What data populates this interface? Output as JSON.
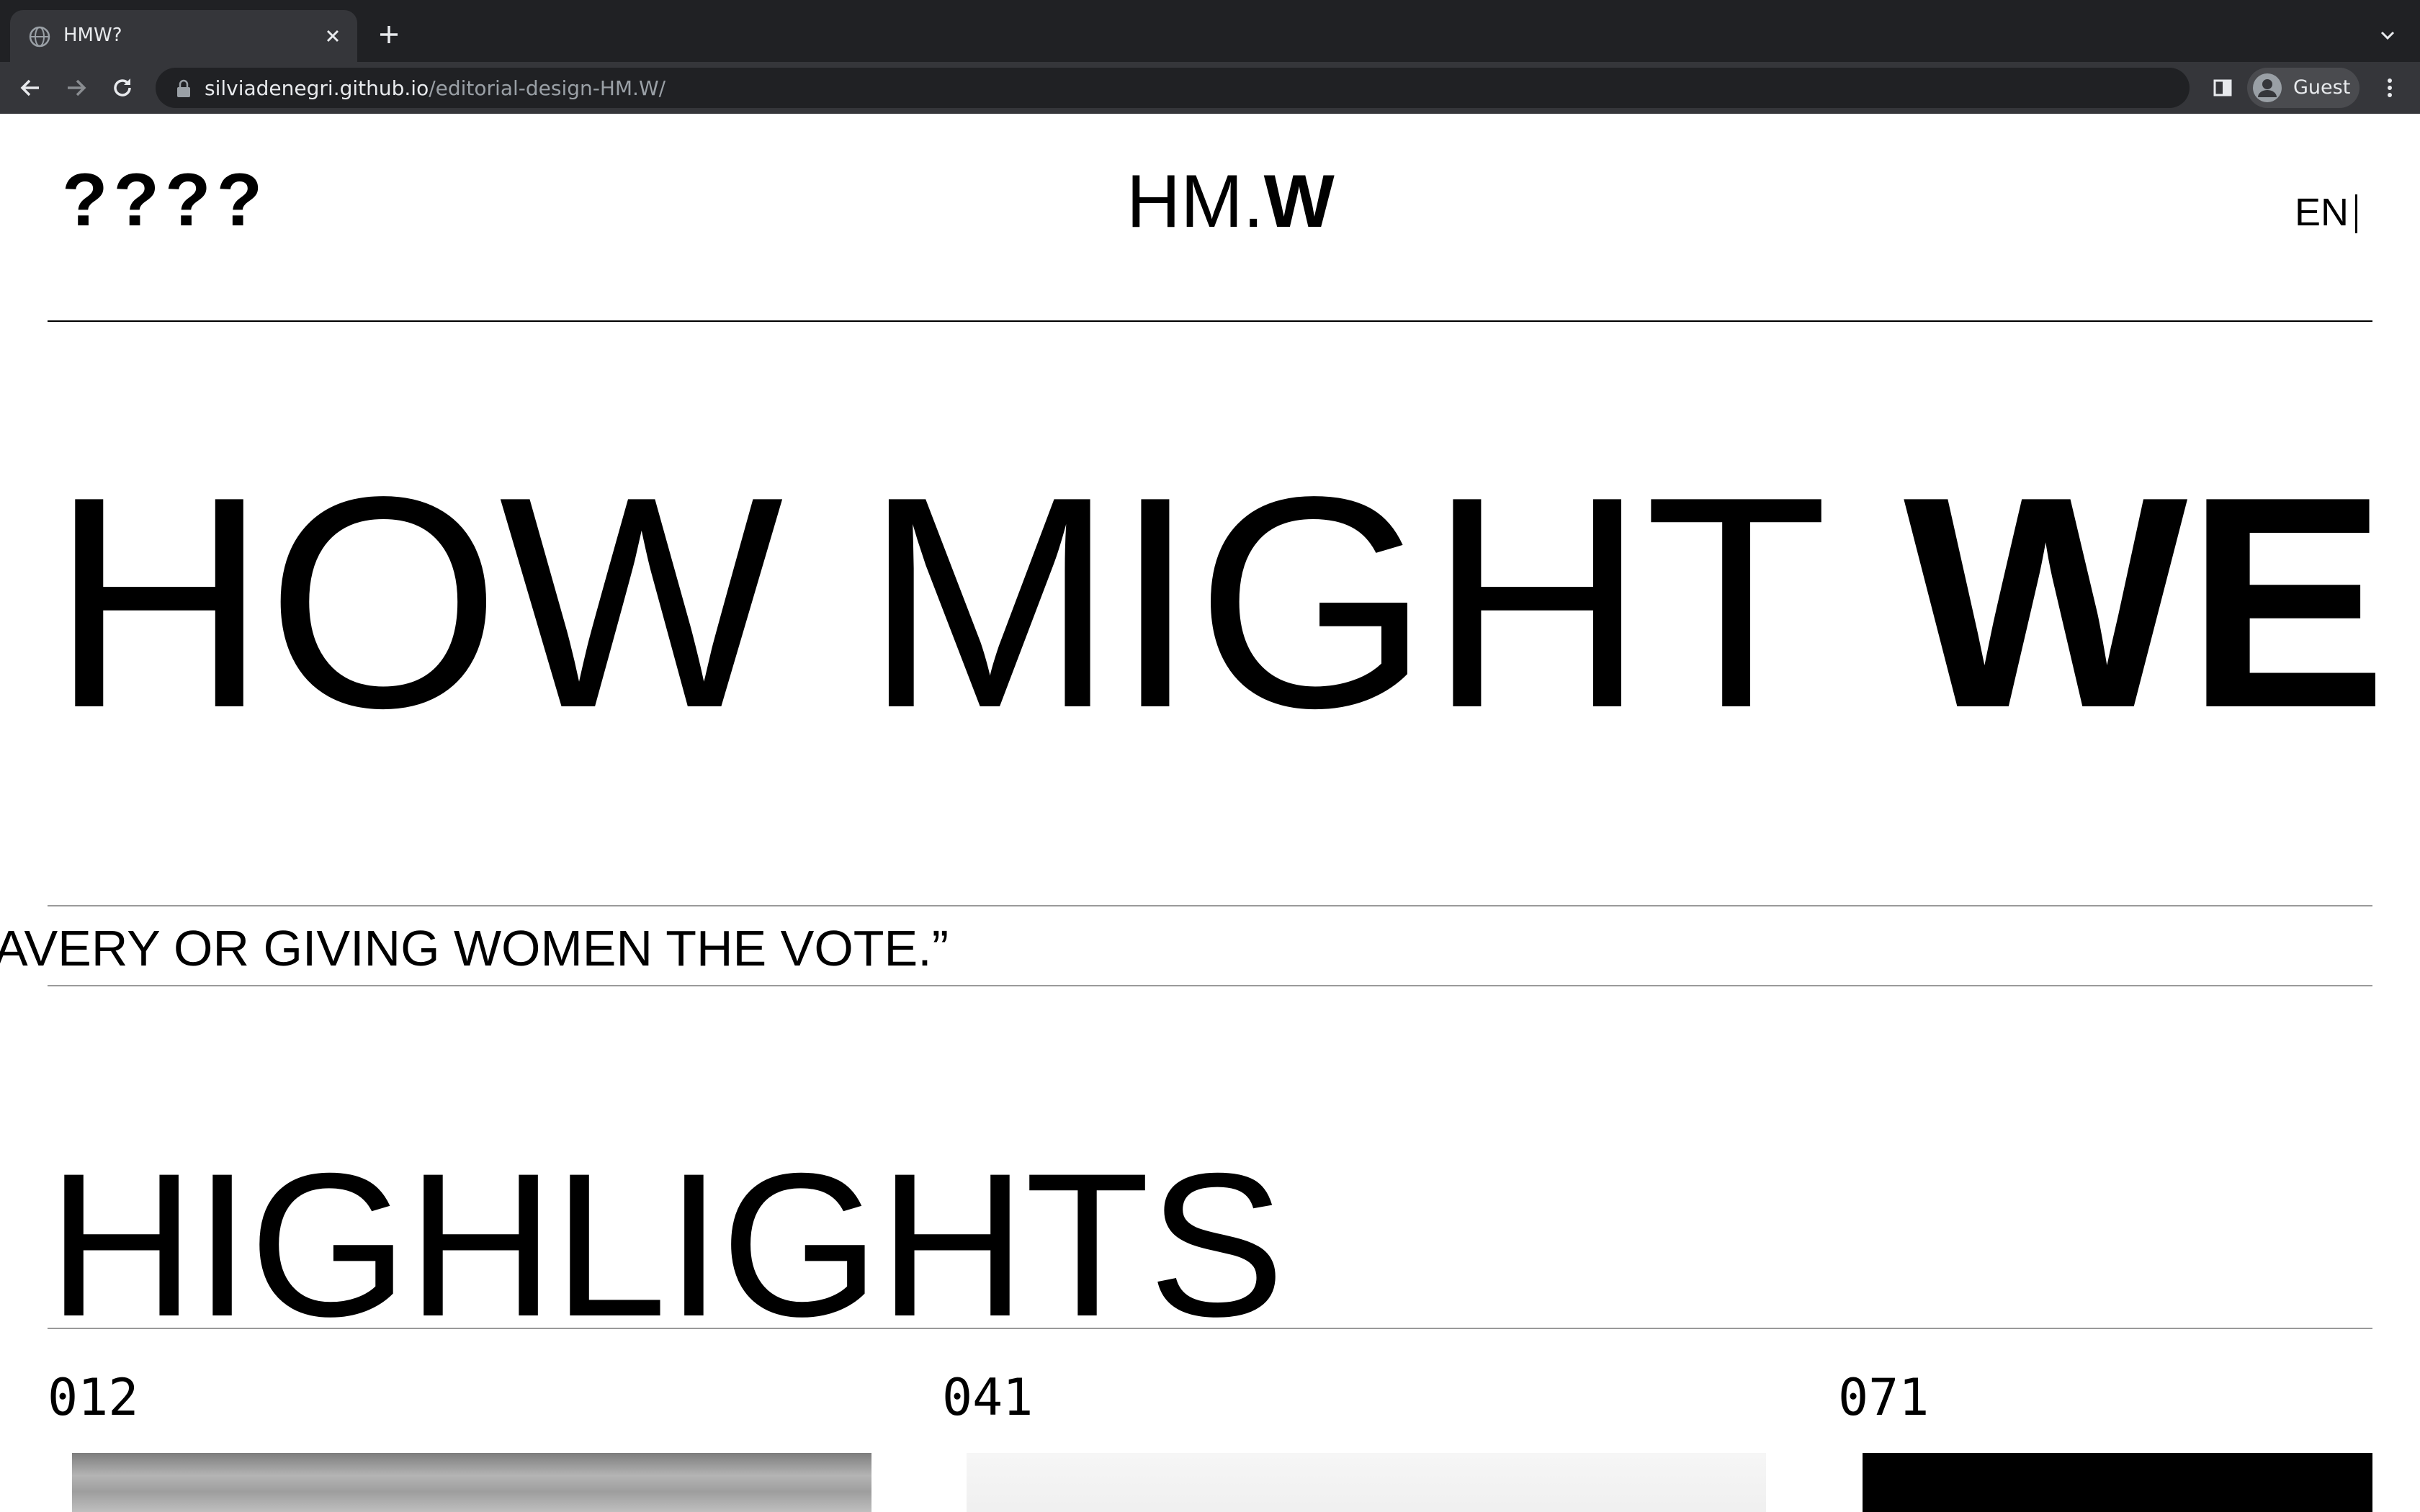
{
  "browser": {
    "tab_title": "HMW?",
    "url_host": "silviadenegri.github.io",
    "url_path": "/editorial-design-HM.W/",
    "profile_name": "Guest"
  },
  "header": {
    "logo_mark": "????",
    "brand_regular": "HM.",
    "brand_bold": "W",
    "language": "EN"
  },
  "hero": {
    "regular": "HOW MIGHT ",
    "bold": "WE"
  },
  "marquee": {
    "text": "AVERY OR GIVING WOMEN THE VOTE.”"
  },
  "highlights": {
    "heading": "HIGHLIGHTS",
    "cards": [
      {
        "number": "012"
      },
      {
        "number": "041"
      },
      {
        "number": "071"
      }
    ]
  }
}
